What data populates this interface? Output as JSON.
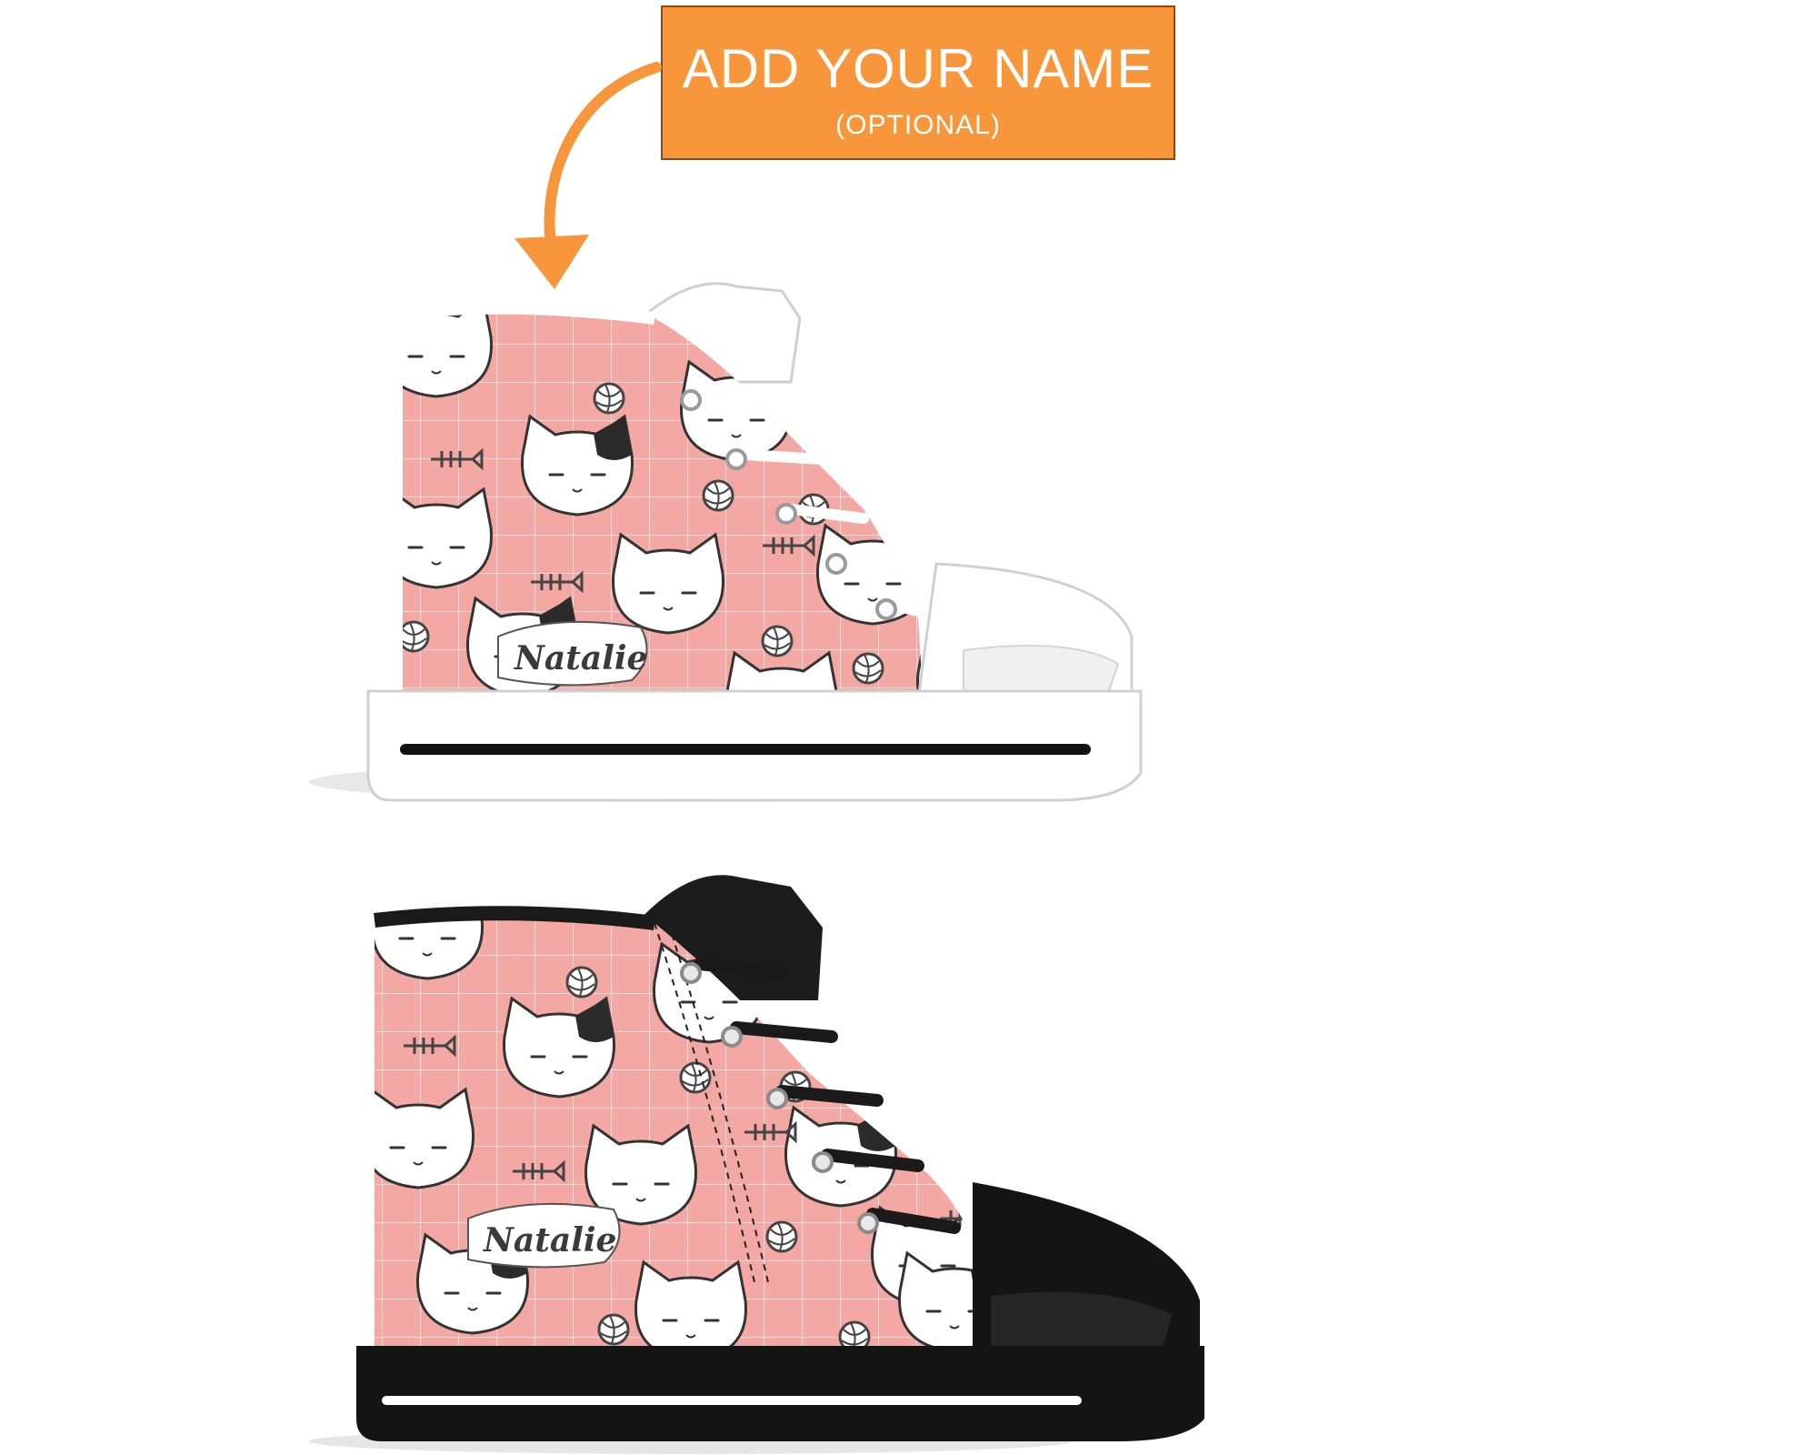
{
  "callout": {
    "title": "ADD YOUR NAME",
    "subtitle": "(OPTIONAL)",
    "color": "#f7963a"
  },
  "shoes": [
    {
      "variant": "white-sole",
      "name_label": "Natalie",
      "upper_color": "#f3a8a4",
      "trim_color": "#ffffff"
    },
    {
      "variant": "black-sole",
      "name_label": "Natalie",
      "upper_color": "#f3a8a4",
      "trim_color": "#1a1a1a"
    }
  ],
  "icons": [
    "arrow-icon",
    "cat-face-icon",
    "yarn-ball-icon",
    "fish-bone-icon"
  ]
}
